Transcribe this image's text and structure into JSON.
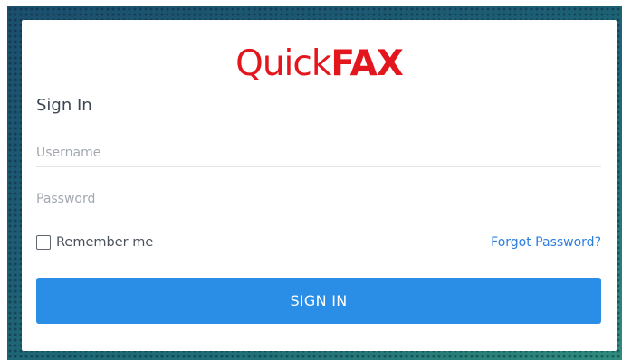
{
  "brand": {
    "logo_part1": "Quick",
    "logo_part2": "FAX",
    "color": "#e4161d"
  },
  "form": {
    "title": "Sign In",
    "username": {
      "placeholder": "Username",
      "value": ""
    },
    "password": {
      "placeholder": "Password",
      "value": ""
    },
    "remember_label": "Remember me",
    "remember_checked": false,
    "forgot_label": "Forgot Password?",
    "submit_label": "SIGN IN"
  },
  "colors": {
    "accent": "#2a8de6",
    "link": "#2b7de0",
    "background_gradient": [
      "#1b4f6d",
      "#2f8c7c"
    ]
  }
}
